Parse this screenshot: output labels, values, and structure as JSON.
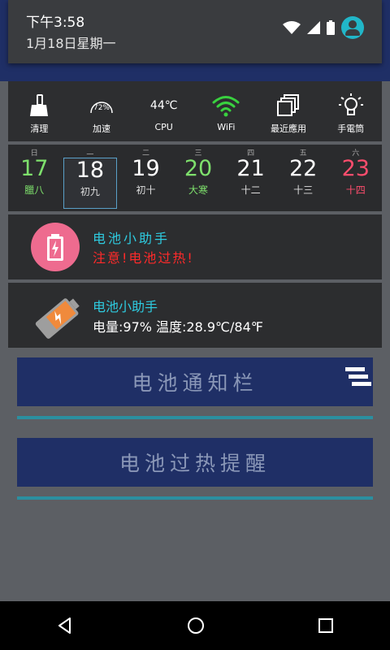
{
  "status": {
    "time": "下午3:58",
    "date": "1月18日星期一"
  },
  "tools": [
    {
      "label": "清理",
      "icon": "broom-icon"
    },
    {
      "label": "加速",
      "icon": "speedometer-icon",
      "value": "72%"
    },
    {
      "label": "CPU",
      "icon": "cpu-temperature",
      "value": "44℃"
    },
    {
      "label": "WiFi",
      "icon": "wifi-icon"
    },
    {
      "label": "最近應用",
      "icon": "recent-apps-icon"
    },
    {
      "label": "手電筒",
      "icon": "flashlight-icon"
    }
  ],
  "calendar": [
    {
      "weekday": "日",
      "day": "17",
      "lunar": "臘八",
      "color": "#7ee06c"
    },
    {
      "weekday": "一",
      "day": "18",
      "lunar": "初九",
      "color": "#ffffff",
      "selected": true
    },
    {
      "weekday": "二",
      "day": "19",
      "lunar": "初十",
      "color": "#ffffff"
    },
    {
      "weekday": "三",
      "day": "20",
      "lunar": "大寒",
      "color": "#7ee06c"
    },
    {
      "weekday": "四",
      "day": "21",
      "lunar": "十二",
      "color": "#ffffff"
    },
    {
      "weekday": "五",
      "day": "22",
      "lunar": "十三",
      "color": "#ffffff"
    },
    {
      "weekday": "六",
      "day": "23",
      "lunar": "十四",
      "color": "#ff4d6d"
    }
  ],
  "notif1": {
    "title": "电池小助手",
    "message": "注意!电池过热!"
  },
  "notif2": {
    "title": "电池小助手",
    "message": "电量:97%  温度:28.9℃/84℉"
  },
  "buttons": {
    "notify": "电池通知栏",
    "overheat": "电池过热提醒"
  }
}
